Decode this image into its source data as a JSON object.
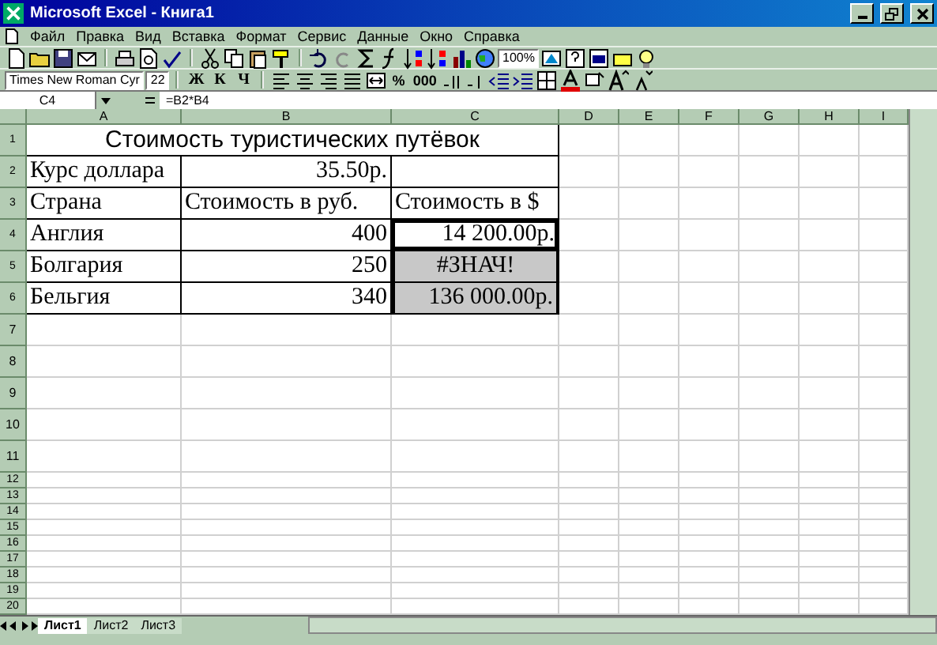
{
  "window": {
    "title": "Microsoft Excel - Книга1"
  },
  "menu": [
    {
      "label": "Файл"
    },
    {
      "label": "Правка"
    },
    {
      "label": "Вид"
    },
    {
      "label": "Вставка"
    },
    {
      "label": "Формат"
    },
    {
      "label": "Сервис"
    },
    {
      "label": "Данные"
    },
    {
      "label": "Окно"
    },
    {
      "label": "Справка"
    }
  ],
  "standard_toolbar": {
    "zoom": "100%"
  },
  "formatting_toolbar": {
    "font": "Times New Roman Cyr",
    "size": "22",
    "style_buttons": [
      "Ж",
      "К",
      "Ч"
    ],
    "number_buttons": [
      "%",
      "000"
    ]
  },
  "formula_bar": {
    "cell_ref": "C4",
    "formula": "=B2*B4"
  },
  "columns": [
    "A",
    "B",
    "C",
    "D",
    "E",
    "F",
    "G",
    "H",
    "I"
  ],
  "sheet": {
    "title_row": {
      "number": "1",
      "text": "Стоимость туристических путёвок"
    },
    "rows": [
      {
        "number": "2",
        "cells": [
          {
            "text": "Курс доллара",
            "kind": "text",
            "selected": false,
            "active": false
          },
          {
            "text": "35.50р.",
            "kind": "number",
            "selected": false,
            "active": false
          },
          {
            "text": "",
            "kind": "text",
            "selected": false,
            "active": false
          }
        ]
      },
      {
        "number": "3",
        "cells": [
          {
            "text": "Страна",
            "kind": "text",
            "selected": false,
            "active": false
          },
          {
            "text": "Стоимость в руб.",
            "kind": "text",
            "selected": false,
            "active": false
          },
          {
            "text": "Стоимость в $",
            "kind": "text",
            "selected": false,
            "active": false
          }
        ]
      },
      {
        "number": "4",
        "cells": [
          {
            "text": "Англия",
            "kind": "text",
            "selected": false,
            "active": false
          },
          {
            "text": "400",
            "kind": "number",
            "selected": false,
            "active": false
          },
          {
            "text": "14 200.00р.",
            "kind": "number",
            "selected": false,
            "active": true
          }
        ]
      },
      {
        "number": "5",
        "cells": [
          {
            "text": "Болгария",
            "kind": "text",
            "selected": false,
            "active": false
          },
          {
            "text": "250",
            "kind": "number",
            "selected": false,
            "active": false
          },
          {
            "text": "#ЗНАЧ!",
            "kind": "error",
            "selected": true,
            "active": false
          }
        ]
      },
      {
        "number": "6",
        "cells": [
          {
            "text": "Бельгия",
            "kind": "text",
            "selected": false,
            "active": false
          },
          {
            "text": "340",
            "kind": "number",
            "selected": false,
            "active": false
          },
          {
            "text": "136 000.00р.",
            "kind": "number",
            "selected": true,
            "active": false
          }
        ]
      }
    ],
    "empty_rows": [
      "7",
      "8",
      "9",
      "10",
      "11",
      "12",
      "13",
      "14",
      "15",
      "16",
      "17",
      "18",
      "19",
      "20"
    ]
  },
  "sheet_tabs": [
    {
      "label": "Лист1",
      "selected": true
    },
    {
      "label": "Лист2",
      "selected": false
    },
    {
      "label": "Лист3",
      "selected": false
    }
  ]
}
